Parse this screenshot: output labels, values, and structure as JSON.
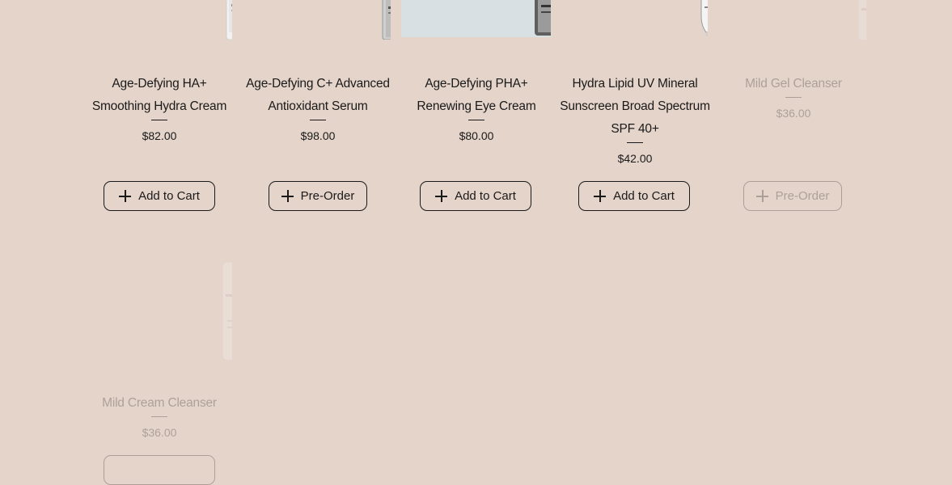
{
  "products": [
    {
      "name_line1": "Age-Defying HA+",
      "name_line2": "Smoothing Hydra Cream",
      "name_line3": "",
      "price": "$82.00",
      "button_label": "Add to Cart",
      "out_of_stock": false
    },
    {
      "name_line1": "Age-Defying C+ Advanced",
      "name_line2": "Antioxidant Serum",
      "name_line3": "",
      "price": "$98.00",
      "button_label": "Pre-Order",
      "out_of_stock": false
    },
    {
      "name_line1": "Age-Defying PHA+",
      "name_line2": "Renewing Eye Cream",
      "name_line3": "",
      "price": "$80.00",
      "button_label": "Add to Cart",
      "out_of_stock": false
    },
    {
      "name_line1": "Hydra Lipid UV Mineral",
      "name_line2": "Sunscreen Broad Spectrum",
      "name_line3": "SPF 40+",
      "price": "$42.00",
      "button_label": "Add to Cart",
      "out_of_stock": false
    },
    {
      "name_line1": "Mild Gel Cleanser",
      "name_line2": "",
      "name_line3": "",
      "price": "$36.00",
      "button_label": "Pre-Order",
      "out_of_stock": true
    },
    {
      "name_line1": "Mild Cream Cleanser",
      "name_line2": "",
      "name_line3": "",
      "price": "$36.00",
      "button_label": "",
      "out_of_stock": true
    }
  ],
  "colors": {
    "background": "#e5d4ca",
    "text": "#1a1a1a",
    "highlight_image_bg": "#d9e0e3"
  }
}
